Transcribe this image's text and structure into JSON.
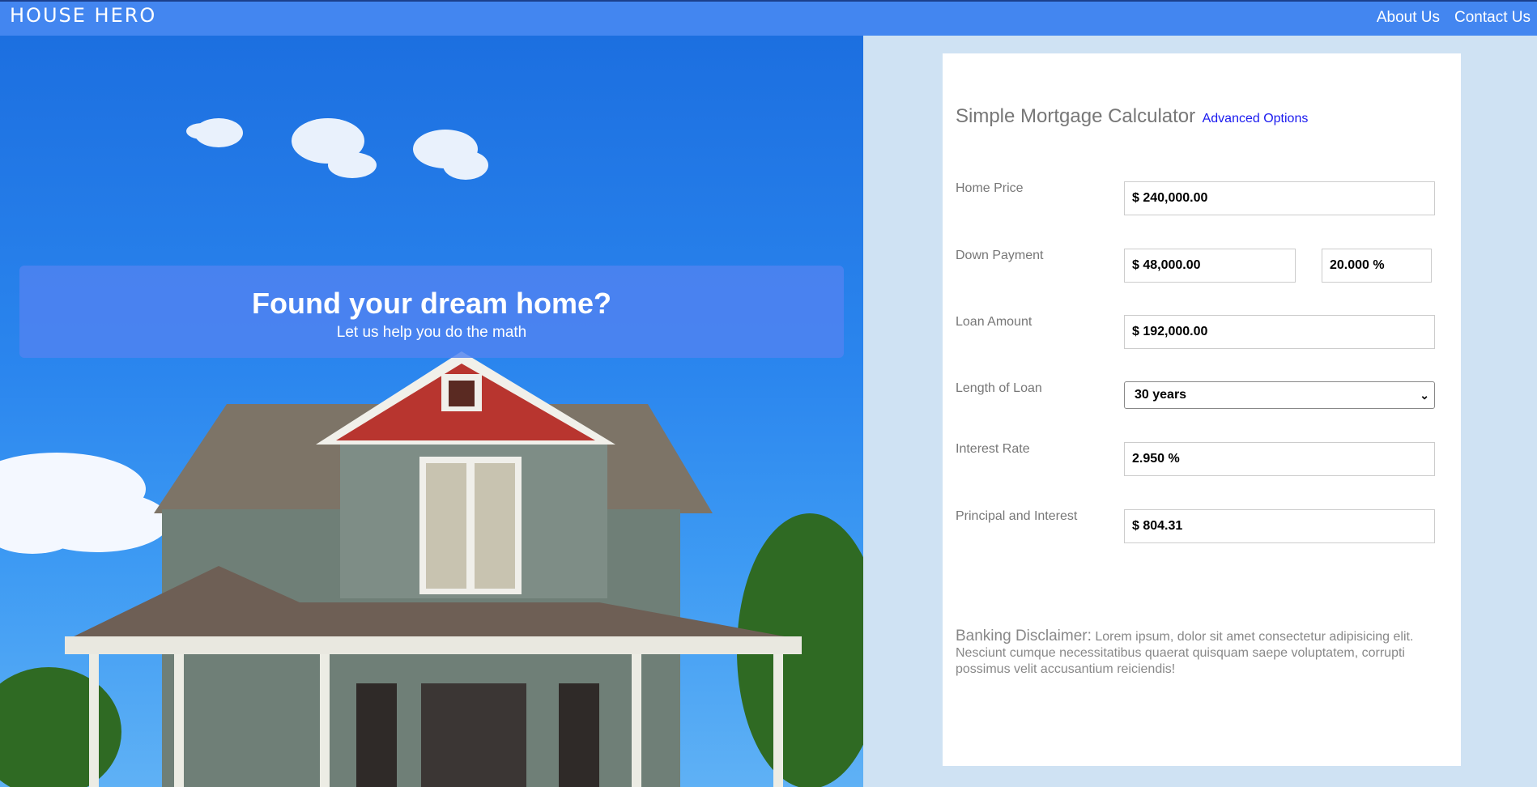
{
  "header": {
    "brand": "HOUSE HERO",
    "nav": [
      "About Us",
      "Contact Us"
    ]
  },
  "hero": {
    "title": "Found your dream home?",
    "subtitle": "Let us help you do the math"
  },
  "calculator": {
    "title": "Simple Mortgage Calculator",
    "advanced_link": "Advanced Options",
    "fields": {
      "home_price": {
        "label": "Home Price",
        "value": "$ 240,000.00"
      },
      "down_payment": {
        "label": "Down Payment",
        "value": "$ 48,000.00",
        "percent": "20.000 %"
      },
      "loan_amount": {
        "label": "Loan Amount",
        "value": "$ 192,000.00"
      },
      "loan_length": {
        "label": "Length of Loan",
        "value": "30 years"
      },
      "interest_rate": {
        "label": "Interest Rate",
        "value": "2.950 %"
      },
      "principal_interest": {
        "label": "Principal and Interest",
        "value": "$ 804.31"
      }
    },
    "disclaimer": {
      "label": "Banking Disclaimer:",
      "text": "Lorem ipsum, dolor sit amet consectetur adipisicing elit. Nesciunt cumque necessitatibus quaerat quisquam saepe voluptatem, corrupti possimus velit accusantium reiciendis!"
    }
  },
  "colors": {
    "header_bg": "#4386f0",
    "page_bg": "#cfe2f3",
    "link": "#1a1aef"
  }
}
